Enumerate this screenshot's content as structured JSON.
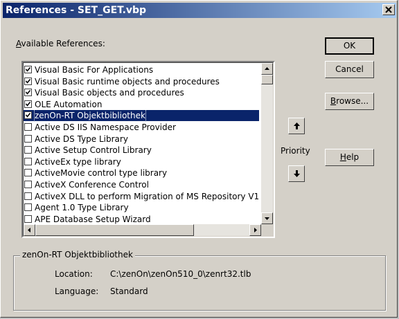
{
  "window": {
    "title": "References - SET_GET.vbp"
  },
  "available_label_prefix": "A",
  "available_label_rest": "vailable References:",
  "references": [
    {
      "label": "Visual Basic For Applications",
      "checked": true,
      "selected": false
    },
    {
      "label": "Visual Basic runtime objects and procedures",
      "checked": true,
      "selected": false
    },
    {
      "label": "Visual Basic objects and procedures",
      "checked": true,
      "selected": false
    },
    {
      "label": "OLE Automation",
      "checked": true,
      "selected": false
    },
    {
      "label": "zenOn-RT Objektbibliothek",
      "checked": true,
      "selected": true
    },
    {
      "label": "Active DS IIS Namespace Provider",
      "checked": false,
      "selected": false
    },
    {
      "label": "Active DS Type Library",
      "checked": false,
      "selected": false
    },
    {
      "label": "Active Setup Control Library",
      "checked": false,
      "selected": false
    },
    {
      "label": "ActiveEx type library",
      "checked": false,
      "selected": false
    },
    {
      "label": "ActiveMovie control type library",
      "checked": false,
      "selected": false
    },
    {
      "label": "ActiveX Conference Control",
      "checked": false,
      "selected": false
    },
    {
      "label": "ActiveX DLL to perform Migration of MS Repository V1",
      "checked": false,
      "selected": false
    },
    {
      "label": "Agent 1.0 Type Library",
      "checked": false,
      "selected": false
    },
    {
      "label": "APE Database Setup Wizard",
      "checked": false,
      "selected": false
    }
  ],
  "buttons": {
    "ok": "OK",
    "cancel": "Cancel",
    "browse_prefix": "B",
    "browse_rest": "rowse...",
    "help_prefix": "H",
    "help_rest": "elp"
  },
  "priority_label": "Priority",
  "details": {
    "group_title": "zenOn-RT Objektbibliothek",
    "location_label": "Location:",
    "location_value": "C:\\zenOn\\zenOn510_0\\zenrt32.tlb",
    "language_label": "Language:",
    "language_value": "Standard"
  },
  "icons": {
    "close": "close-icon",
    "up_arrow": "arrow-up-icon",
    "down_arrow": "arrow-down-icon",
    "scroll_up": "scroll-up-icon",
    "scroll_down": "scroll-down-icon",
    "scroll_left": "scroll-left-icon",
    "scroll_right": "scroll-right-icon",
    "check": "check-icon"
  },
  "colors": {
    "title_start": "#0a246a",
    "title_end": "#a6caf0",
    "selection": "#0a246a",
    "face": "#d4d0c8"
  }
}
